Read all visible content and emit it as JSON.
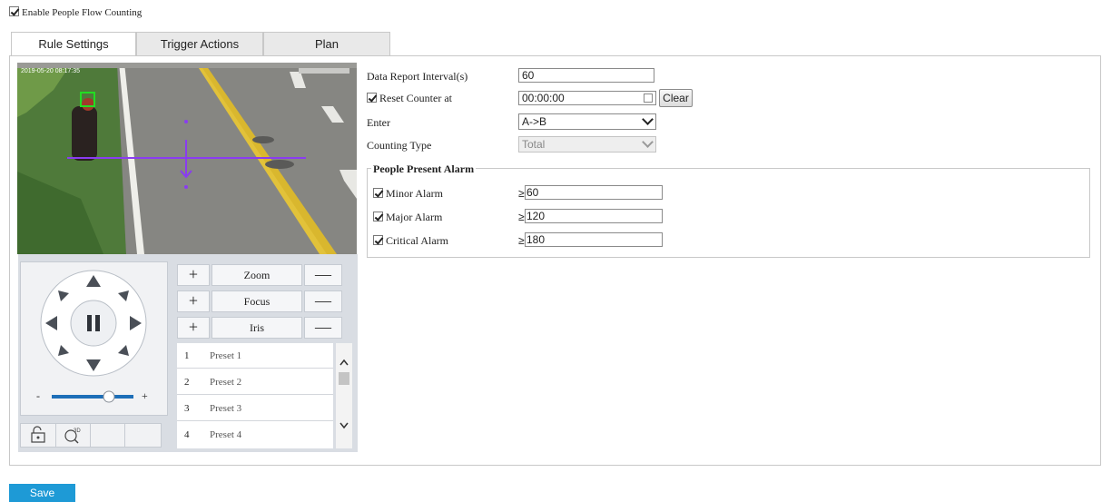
{
  "enable_checkbox": {
    "label": "Enable People Flow Counting",
    "checked": true
  },
  "tabs": [
    {
      "label": "Rule Settings",
      "active": true
    },
    {
      "label": "Trigger Actions",
      "active": false
    },
    {
      "label": "Plan",
      "active": false
    }
  ],
  "video": {
    "osd_text": "2019-05-20 08:17:35"
  },
  "ptz": {
    "zoom_label": "Zoom",
    "focus_label": "Focus",
    "iris_label": "Iris",
    "speed_min": "-",
    "speed_max": "+",
    "speed_level": 0.7,
    "presets": [
      {
        "num": "1",
        "name": "Preset 1"
      },
      {
        "num": "2",
        "name": "Preset 2"
      },
      {
        "num": "3",
        "name": "Preset 3"
      },
      {
        "num": "4",
        "name": "Preset 4"
      }
    ]
  },
  "settings": {
    "report_interval_label": "Data Report Interval(s)",
    "report_interval_value": "60",
    "reset_counter_label": "Reset Counter at",
    "reset_counter_checked": true,
    "reset_counter_value": "00:00:00",
    "clear_label": "Clear",
    "enter_label": "Enter",
    "enter_value": "A->B",
    "counting_type_label": "Counting Type",
    "counting_type_value": "Total"
  },
  "alarm_group": {
    "title": "People Present Alarm",
    "alarms": [
      {
        "label": "Minor Alarm",
        "checked": true,
        "prefix": "≥",
        "value": "60"
      },
      {
        "label": "Major Alarm",
        "checked": true,
        "prefix": "≥",
        "value": "120"
      },
      {
        "label": "Critical Alarm",
        "checked": true,
        "prefix": "≥",
        "value": "180"
      }
    ]
  },
  "save_label": "Save",
  "colors": {
    "accent": "#1e9ad6",
    "line": "#8a3cf0",
    "box": "#22dd22"
  }
}
